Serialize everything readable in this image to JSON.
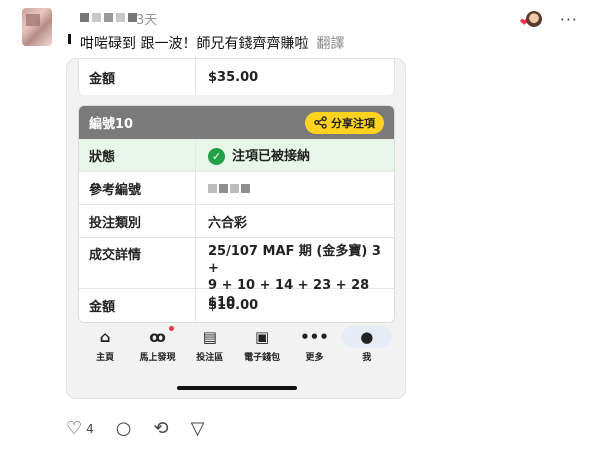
{
  "post": {
    "time": "3天",
    "text": "咁啱碌到 跟一波！師兄有錢齊齊賺啦",
    "translate": "翻譯"
  },
  "shot": {
    "prev_row": {
      "label": "金額",
      "value": "$35.00"
    },
    "card": {
      "title": "編號10",
      "share_label": "分享注項",
      "rows": [
        {
          "label": "狀態",
          "value": "注項已被接納"
        },
        {
          "label": "參考編號",
          "value": ""
        },
        {
          "label": "投注類別",
          "value": "六合彩"
        },
        {
          "label": "成交詳情",
          "value_line1": "25/107 MAF 期 (金多寶) 3 +",
          "value_line2": "9 + 10 + 14 + 23 + 28 $10"
        },
        {
          "label": "金額",
          "value": "$10.00"
        }
      ]
    },
    "nav": [
      {
        "label": "主頁",
        "icon": "home-icon"
      },
      {
        "label": "馬上發現",
        "icon": "binoculars-icon"
      },
      {
        "label": "投注區",
        "icon": "bet-slip-icon"
      },
      {
        "label": "電子錢包",
        "icon": "wallet-icon"
      },
      {
        "label": "更多",
        "icon": "more-icon"
      },
      {
        "label": "我",
        "icon": "person-icon"
      }
    ]
  },
  "actions": {
    "like_count": "4"
  }
}
